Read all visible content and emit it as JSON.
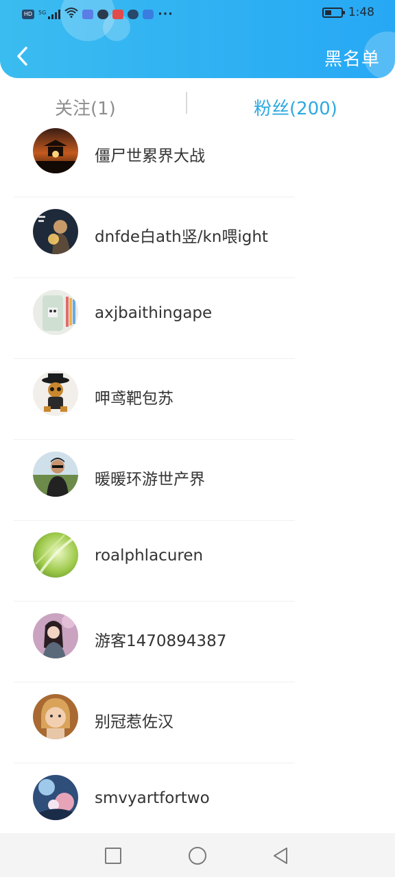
{
  "status_bar": {
    "left_icons": [
      "hd-icon",
      "signal-5g-icon",
      "wifi-icon",
      "music-icon",
      "wechat-icon",
      "news-icon",
      "browser-icon",
      "app-icon",
      "more-dots-icon"
    ],
    "network": "5G",
    "more": "···",
    "time": "1:48"
  },
  "header": {
    "back_icon": "chevron-left-icon",
    "blacklist_label": "黑名单",
    "colors": {
      "start": "#3bbcf0",
      "end": "#27a8f4"
    }
  },
  "tabs": {
    "follow_label": "关注(1)",
    "fans_label": "粉丝(200)",
    "active": "fans",
    "active_color": "#2ea9df",
    "inactive_color": "#8d8d8d"
  },
  "fans": [
    {
      "name": "僵尸世累界大战",
      "avatar": "sunset-pavilion"
    },
    {
      "name": "dnfde白ath竖/kn喂ight",
      "avatar": "girl-lantern"
    },
    {
      "name": "axjbaithingape",
      "avatar": "phone-case"
    },
    {
      "name": "呷鸢靶包苏",
      "avatar": "toy-figure-hat"
    },
    {
      "name": "暖暖环游世产界",
      "avatar": "man-sunglasses"
    },
    {
      "name": "roalphlacuren",
      "avatar": "green-leaves"
    },
    {
      "name": "游客1470894387",
      "avatar": "woman-portrait"
    },
    {
      "name": "别冠惹佐汉",
      "avatar": "child-portrait"
    },
    {
      "name": "smvyartfortwo",
      "avatar": "anime-art"
    }
  ],
  "nav_bar": {
    "buttons": [
      "recent-apps-square-icon",
      "home-circle-icon",
      "back-triangle-icon"
    ]
  }
}
